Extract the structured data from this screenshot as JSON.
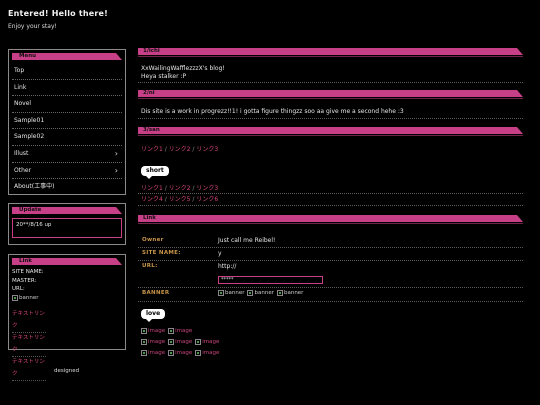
{
  "header": {
    "title": "Entered! Hello there!",
    "subtitle": "Enjoy your stay!"
  },
  "menu": {
    "heading": "Menu",
    "items": [
      {
        "label": "Top",
        "has_arrow": false
      },
      {
        "label": "Link",
        "has_arrow": false
      },
      {
        "label": "Novel",
        "has_arrow": false
      },
      {
        "label": "Sample01",
        "has_arrow": false
      },
      {
        "label": "Sample02",
        "has_arrow": false
      },
      {
        "label": "Illust",
        "has_arrow": true
      },
      {
        "label": "Other",
        "has_arrow": true
      },
      {
        "label": "About(工事中)",
        "has_arrow": false
      }
    ]
  },
  "update": {
    "heading": "Update",
    "text": "20**/8/16 up"
  },
  "sidebar_link": {
    "heading": "Link",
    "site_name": "SITE NAME:",
    "master": "MASTER:",
    "url": "URL:",
    "banner": "banner",
    "text_links": [
      "テキストリンク",
      "テキストリンク",
      "テキストリンク"
    ]
  },
  "footer": {
    "designed": "designed"
  },
  "sections": {
    "s1": {
      "title": "1/ichi",
      "line1": "XxWailingWafflezzzX's blog!",
      "line2": "Heya stalker :P"
    },
    "s2": {
      "title": "2/ni",
      "line1": "Dis site is a work in progrezz!!1! i gotta figure thingzz soo aa give me a second hehe :3"
    },
    "s3": {
      "title": "3/san",
      "links_row1": [
        "リンク1",
        "リンク2",
        "リンク3"
      ],
      "short_label": "short",
      "links_row2": [
        "リンク1",
        "リンク2",
        "リンク3"
      ],
      "links_row3": [
        "リンク4",
        "リンク5",
        "リンク6"
      ]
    },
    "link": {
      "title": "Link",
      "owner_label": "Owner",
      "owner_value": "Just call me Reibel!",
      "site_name_label": "SITE NAME:",
      "site_name_value": "y",
      "url_label": "URL:",
      "url_value": "http://",
      "password_value": "*****",
      "banner_label": "BANNER",
      "banners": [
        "banner",
        "banner",
        "banner"
      ],
      "love_label": "love",
      "images_row1": [
        "image",
        "image"
      ],
      "images_row2": [
        "image",
        "image",
        "image"
      ],
      "images_row3": [
        "image",
        "image",
        "image"
      ]
    }
  },
  "colors": {
    "accent": "#c73f87",
    "link": "#d9457e",
    "label": "#c9954a",
    "background": "#000000"
  }
}
